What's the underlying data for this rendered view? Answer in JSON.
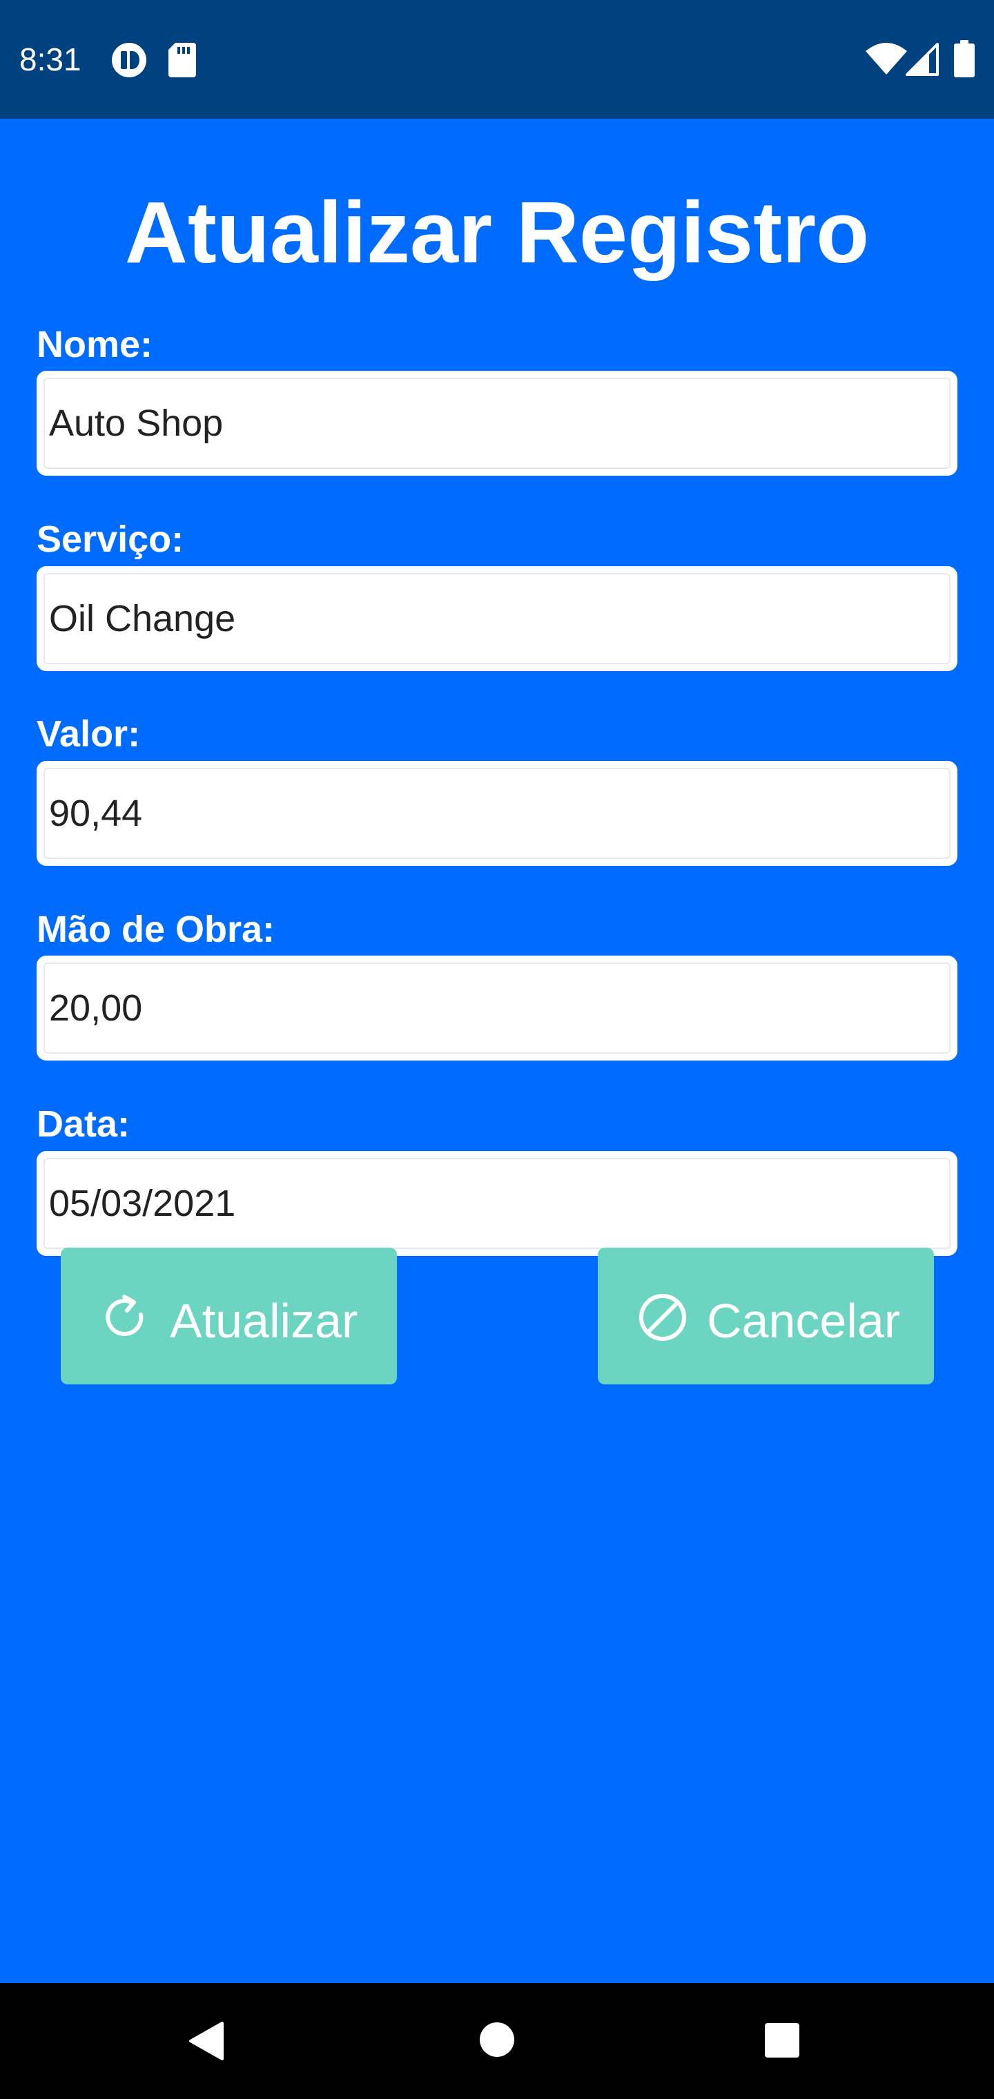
{
  "status_bar": {
    "time": "8:31",
    "left_icons": [
      "app-notification-icon",
      "sd-card-icon"
    ],
    "right_icons": [
      "wifi-icon",
      "cell-signal-icon",
      "battery-icon"
    ]
  },
  "page": {
    "title": "Atualizar Registro"
  },
  "form": {
    "nome": {
      "label": "Nome:",
      "value": "Auto Shop"
    },
    "servico": {
      "label": "Serviço:",
      "value": "Oil Change"
    },
    "valor": {
      "label": "Valor:",
      "value": "90,44"
    },
    "mao_de_obra": {
      "label": "Mão de Obra:",
      "value": "20,00"
    },
    "data": {
      "label": "Data:",
      "value": "05/03/2021"
    }
  },
  "buttons": {
    "update": {
      "label": "Atualizar",
      "icon": "refresh-icon"
    },
    "cancel": {
      "label": "Cancelar",
      "icon": "cancel-icon"
    }
  },
  "nav_bar": {
    "icons": [
      "back-icon",
      "home-icon",
      "recents-icon"
    ]
  },
  "colors": {
    "background": "#006cff",
    "status_bar": "#00427f",
    "button": "#6bd5c2",
    "text_light": "#ffffff"
  }
}
